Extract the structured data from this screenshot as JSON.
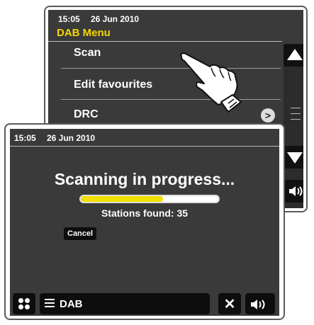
{
  "back_screen": {
    "time": "15:05",
    "date": "26 Jun 2010",
    "title": "DAB Menu",
    "items": [
      {
        "label": "Scan"
      },
      {
        "label": "Edit favourites"
      },
      {
        "label": "DRC"
      }
    ],
    "drc_arrow": ">",
    "icons": [
      "up-arrow-icon",
      "scroll-indicator-icon",
      "down-arrow-icon",
      "volume-icon"
    ]
  },
  "front_screen": {
    "time": "15:05",
    "date": "26 Jun 2010",
    "title": "Scanning in progress...",
    "progress": 0.6,
    "stations": "Stations found: 35",
    "cancel_label": "Cancel",
    "bottom_bar": {
      "mode_label": "DAB",
      "icons": [
        "grid-icon",
        "menu-icon",
        "close-icon",
        "volume-icon"
      ]
    }
  },
  "colors": {
    "screen_bg": "#3a3a3a",
    "title_yellow": "#f5d800",
    "progress_fill": "#f2e000",
    "button_bg": "#0d0d0d"
  }
}
